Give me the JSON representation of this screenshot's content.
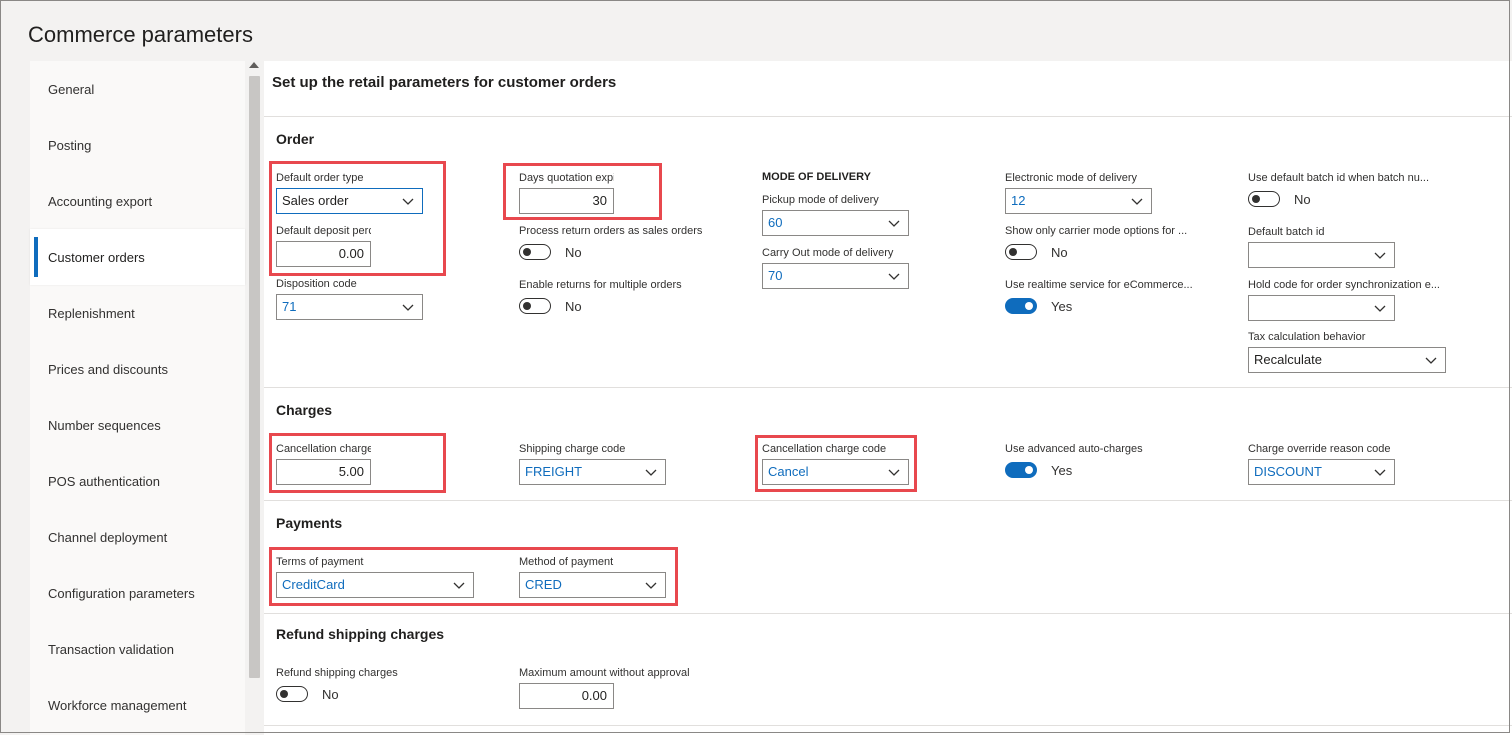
{
  "page_title": "Commerce parameters",
  "sidebar": {
    "items": [
      {
        "label": "General"
      },
      {
        "label": "Posting"
      },
      {
        "label": "Accounting export"
      },
      {
        "label": "Customer orders"
      },
      {
        "label": "Replenishment"
      },
      {
        "label": "Prices and discounts"
      },
      {
        "label": "Number sequences"
      },
      {
        "label": "POS authentication"
      },
      {
        "label": "Channel deployment"
      },
      {
        "label": "Configuration parameters"
      },
      {
        "label": "Transaction validation"
      },
      {
        "label": "Workforce management"
      }
    ],
    "active_index": 3
  },
  "content_header": "Set up the retail parameters for customer orders",
  "order": {
    "title": "Order",
    "default_order_type": {
      "label": "Default order type",
      "value": "Sales order"
    },
    "default_deposit_percentage": {
      "label": "Default deposit percentage",
      "value": "0.00"
    },
    "disposition_code": {
      "label": "Disposition code",
      "value": "71"
    },
    "days_quotation_expires": {
      "label": "Days quotation expires",
      "value": "30"
    },
    "process_return_orders": {
      "label": "Process return orders as sales orders",
      "value": "No"
    },
    "enable_returns_multiple": {
      "label": "Enable returns for multiple orders",
      "value": "No"
    },
    "mode_of_delivery_heading": "MODE OF DELIVERY",
    "pickup_mode": {
      "label": "Pickup mode of delivery",
      "value": "60"
    },
    "carry_out_mode": {
      "label": "Carry Out mode of delivery",
      "value": "70"
    },
    "electronic_mode": {
      "label": "Electronic mode of delivery",
      "value": "12"
    },
    "show_only_carrier": {
      "label": "Show only carrier mode options for ...",
      "value": "No"
    },
    "use_realtime_service": {
      "label": "Use realtime service for eCommerce...",
      "value": "Yes"
    },
    "use_default_batch_id": {
      "label": "Use default batch id when batch nu...",
      "value": "No"
    },
    "default_batch_id": {
      "label": "Default batch id",
      "value": ""
    },
    "hold_code": {
      "label": "Hold code for order synchronization e...",
      "value": ""
    },
    "tax_calculation": {
      "label": "Tax calculation behavior",
      "value": "Recalculate"
    }
  },
  "charges": {
    "title": "Charges",
    "cancellation_charge_percentage": {
      "label": "Cancellation charge percentage",
      "value": "5.00"
    },
    "shipping_charge_code": {
      "label": "Shipping charge code",
      "value": "FREIGHT"
    },
    "cancellation_charge_code": {
      "label": "Cancellation charge code",
      "value": "Cancel"
    },
    "use_advanced_auto_charges": {
      "label": "Use advanced auto-charges",
      "value": "Yes"
    },
    "charge_override_reason_code": {
      "label": "Charge override reason code",
      "value": "DISCOUNT"
    }
  },
  "payments": {
    "title": "Payments",
    "terms_of_payment": {
      "label": "Terms of payment",
      "value": "CreditCard"
    },
    "method_of_payment": {
      "label": "Method of payment",
      "value": "CRED"
    }
  },
  "refund": {
    "title": "Refund shipping charges",
    "refund_shipping_charges": {
      "label": "Refund shipping charges",
      "value": "No"
    },
    "max_amount_without_approval": {
      "label": "Maximum amount without approval",
      "value": "0.00"
    }
  },
  "colors": {
    "accent": "#0f6cbd",
    "highlight": "#e8484e",
    "link_text": "#0f6cbd"
  }
}
